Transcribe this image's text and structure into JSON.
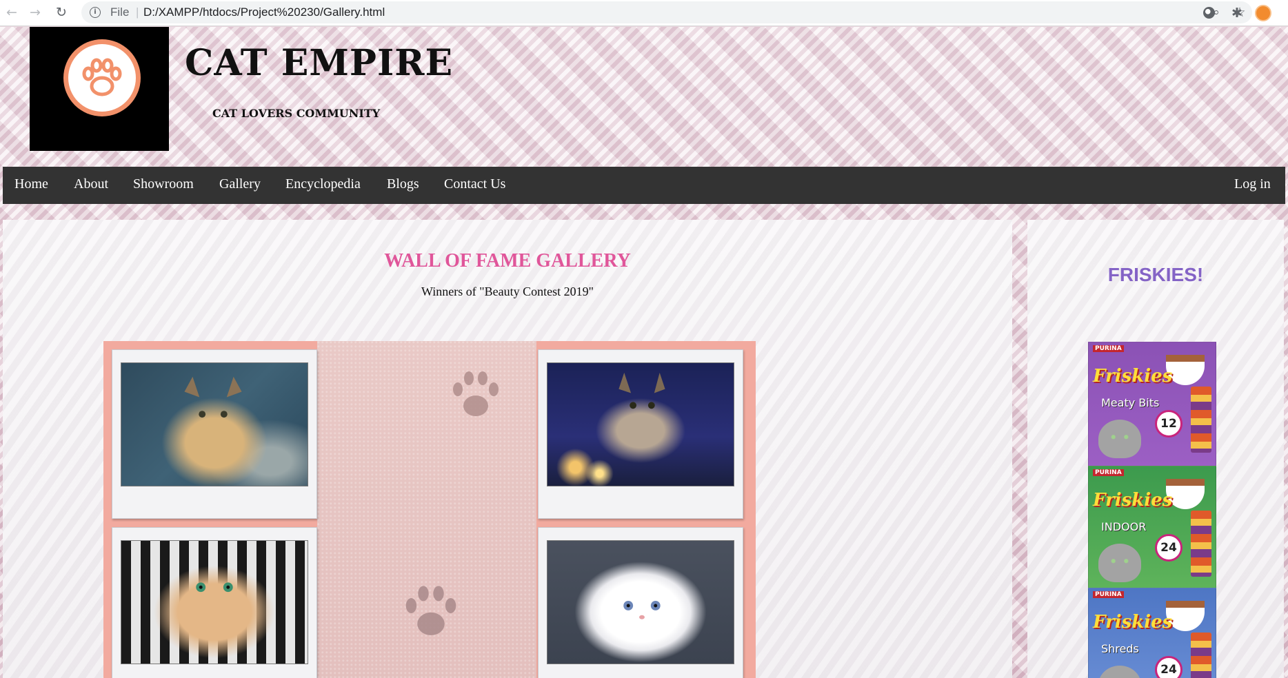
{
  "browser": {
    "back_icon": "arrow-left-icon",
    "forward_icon": "arrow-right-icon",
    "reload_icon": "reload-icon",
    "scheme_label": "File",
    "separator": "|",
    "url": "D:/XAMPP/htdocs/Project%20230/Gallery.html",
    "zoom_icon": "zoom-icon",
    "bookmark_icon": "star-icon",
    "extensions": [
      "circle-extension-icon",
      "puzzle-extensions-icon",
      "profile-avatar-icon"
    ]
  },
  "header": {
    "logo_icon": "paw-icon",
    "title": "CAT EMPIRE",
    "tagline": "CAT LOVERS COMMUNITY",
    "logo_color": "#f2916a"
  },
  "nav": {
    "items": [
      {
        "label": "Home"
      },
      {
        "label": "About"
      },
      {
        "label": "Showroom"
      },
      {
        "label": "Gallery"
      },
      {
        "label": "Encyclopedia"
      },
      {
        "label": "Blogs"
      },
      {
        "label": "Contact Us"
      }
    ],
    "login": "Log in",
    "bar_color": "#333333"
  },
  "gallery": {
    "title": "WALL OF FAME GALLERY",
    "subtitle": "Winners of \"Beauty Contest 2019\"",
    "title_color": "#e0569a",
    "photos": [
      {
        "icon": "tabby-cat-photo"
      },
      {
        "icon": "tabby-cat-city-night-photo"
      },
      {
        "icon": "ginger-longhair-cat-photo"
      },
      {
        "icon": "white-persian-kitten-photo"
      }
    ],
    "frame_color": "#f2aa9f"
  },
  "sidebar": {
    "ad_title": "FRISKIES!",
    "ad_color": "#8463c6",
    "products": [
      {
        "brand": "Friskies",
        "variant": "Meaty Bits",
        "count": "12",
        "maker": "PURINA"
      },
      {
        "brand": "Friskies",
        "variant": "INDOOR",
        "count": "24",
        "maker": "PURINA"
      },
      {
        "brand": "Friskies",
        "variant": "Shreds",
        "count": "24",
        "maker": "PURINA"
      }
    ]
  }
}
